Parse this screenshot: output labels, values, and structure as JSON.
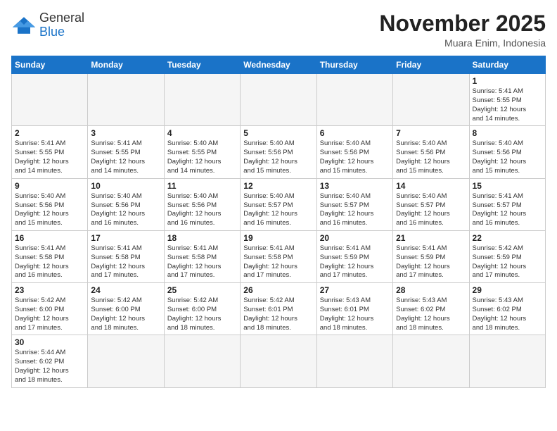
{
  "header": {
    "logo_general": "General",
    "logo_blue": "Blue",
    "month_title": "November 2025",
    "location": "Muara Enim, Indonesia"
  },
  "days_of_week": [
    "Sunday",
    "Monday",
    "Tuesday",
    "Wednesday",
    "Thursday",
    "Friday",
    "Saturday"
  ],
  "weeks": [
    [
      {
        "day": "",
        "info": ""
      },
      {
        "day": "",
        "info": ""
      },
      {
        "day": "",
        "info": ""
      },
      {
        "day": "",
        "info": ""
      },
      {
        "day": "",
        "info": ""
      },
      {
        "day": "",
        "info": ""
      },
      {
        "day": "1",
        "info": "Sunrise: 5:41 AM\nSunset: 5:55 PM\nDaylight: 12 hours\nand 14 minutes."
      }
    ],
    [
      {
        "day": "2",
        "info": "Sunrise: 5:41 AM\nSunset: 5:55 PM\nDaylight: 12 hours\nand 14 minutes."
      },
      {
        "day": "3",
        "info": "Sunrise: 5:41 AM\nSunset: 5:55 PM\nDaylight: 12 hours\nand 14 minutes."
      },
      {
        "day": "4",
        "info": "Sunrise: 5:40 AM\nSunset: 5:55 PM\nDaylight: 12 hours\nand 14 minutes."
      },
      {
        "day": "5",
        "info": "Sunrise: 5:40 AM\nSunset: 5:56 PM\nDaylight: 12 hours\nand 15 minutes."
      },
      {
        "day": "6",
        "info": "Sunrise: 5:40 AM\nSunset: 5:56 PM\nDaylight: 12 hours\nand 15 minutes."
      },
      {
        "day": "7",
        "info": "Sunrise: 5:40 AM\nSunset: 5:56 PM\nDaylight: 12 hours\nand 15 minutes."
      },
      {
        "day": "8",
        "info": "Sunrise: 5:40 AM\nSunset: 5:56 PM\nDaylight: 12 hours\nand 15 minutes."
      }
    ],
    [
      {
        "day": "9",
        "info": "Sunrise: 5:40 AM\nSunset: 5:56 PM\nDaylight: 12 hours\nand 15 minutes."
      },
      {
        "day": "10",
        "info": "Sunrise: 5:40 AM\nSunset: 5:56 PM\nDaylight: 12 hours\nand 16 minutes."
      },
      {
        "day": "11",
        "info": "Sunrise: 5:40 AM\nSunset: 5:56 PM\nDaylight: 12 hours\nand 16 minutes."
      },
      {
        "day": "12",
        "info": "Sunrise: 5:40 AM\nSunset: 5:57 PM\nDaylight: 12 hours\nand 16 minutes."
      },
      {
        "day": "13",
        "info": "Sunrise: 5:40 AM\nSunset: 5:57 PM\nDaylight: 12 hours\nand 16 minutes."
      },
      {
        "day": "14",
        "info": "Sunrise: 5:40 AM\nSunset: 5:57 PM\nDaylight: 12 hours\nand 16 minutes."
      },
      {
        "day": "15",
        "info": "Sunrise: 5:41 AM\nSunset: 5:57 PM\nDaylight: 12 hours\nand 16 minutes."
      }
    ],
    [
      {
        "day": "16",
        "info": "Sunrise: 5:41 AM\nSunset: 5:58 PM\nDaylight: 12 hours\nand 16 minutes."
      },
      {
        "day": "17",
        "info": "Sunrise: 5:41 AM\nSunset: 5:58 PM\nDaylight: 12 hours\nand 17 minutes."
      },
      {
        "day": "18",
        "info": "Sunrise: 5:41 AM\nSunset: 5:58 PM\nDaylight: 12 hours\nand 17 minutes."
      },
      {
        "day": "19",
        "info": "Sunrise: 5:41 AM\nSunset: 5:58 PM\nDaylight: 12 hours\nand 17 minutes."
      },
      {
        "day": "20",
        "info": "Sunrise: 5:41 AM\nSunset: 5:59 PM\nDaylight: 12 hours\nand 17 minutes."
      },
      {
        "day": "21",
        "info": "Sunrise: 5:41 AM\nSunset: 5:59 PM\nDaylight: 12 hours\nand 17 minutes."
      },
      {
        "day": "22",
        "info": "Sunrise: 5:42 AM\nSunset: 5:59 PM\nDaylight: 12 hours\nand 17 minutes."
      }
    ],
    [
      {
        "day": "23",
        "info": "Sunrise: 5:42 AM\nSunset: 6:00 PM\nDaylight: 12 hours\nand 17 minutes."
      },
      {
        "day": "24",
        "info": "Sunrise: 5:42 AM\nSunset: 6:00 PM\nDaylight: 12 hours\nand 18 minutes."
      },
      {
        "day": "25",
        "info": "Sunrise: 5:42 AM\nSunset: 6:00 PM\nDaylight: 12 hours\nand 18 minutes."
      },
      {
        "day": "26",
        "info": "Sunrise: 5:42 AM\nSunset: 6:01 PM\nDaylight: 12 hours\nand 18 minutes."
      },
      {
        "day": "27",
        "info": "Sunrise: 5:43 AM\nSunset: 6:01 PM\nDaylight: 12 hours\nand 18 minutes."
      },
      {
        "day": "28",
        "info": "Sunrise: 5:43 AM\nSunset: 6:02 PM\nDaylight: 12 hours\nand 18 minutes."
      },
      {
        "day": "29",
        "info": "Sunrise: 5:43 AM\nSunset: 6:02 PM\nDaylight: 12 hours\nand 18 minutes."
      }
    ],
    [
      {
        "day": "30",
        "info": "Sunrise: 5:44 AM\nSunset: 6:02 PM\nDaylight: 12 hours\nand 18 minutes."
      },
      {
        "day": "",
        "info": ""
      },
      {
        "day": "",
        "info": ""
      },
      {
        "day": "",
        "info": ""
      },
      {
        "day": "",
        "info": ""
      },
      {
        "day": "",
        "info": ""
      },
      {
        "day": "",
        "info": ""
      }
    ]
  ]
}
